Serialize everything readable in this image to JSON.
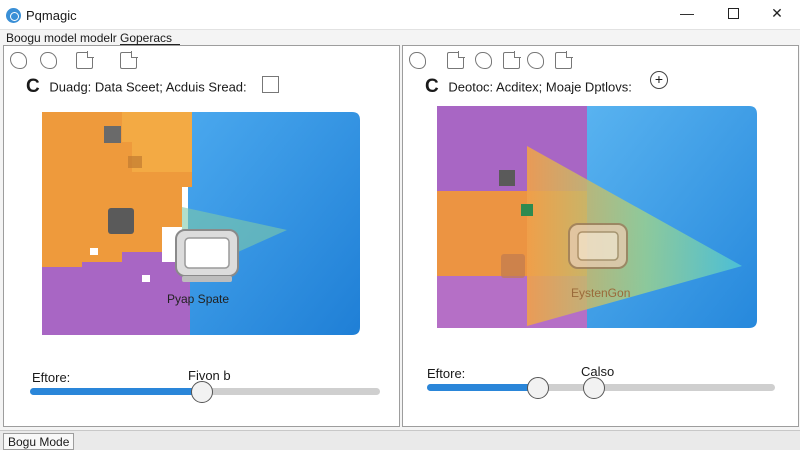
{
  "window": {
    "title": "Pqmagic",
    "minimize_glyph": "—",
    "close_glyph": "✕"
  },
  "menu": {
    "items": [
      "Boogu model modelr",
      "Goperacs"
    ]
  },
  "left_panel": {
    "header_letter": "C",
    "header_text": "Duadg: Data Sceet; Acduis Sread:",
    "canvas_label": "Pyap Spate",
    "slider": {
      "label": "Eftore:",
      "caption": "Fivon b",
      "value_fraction": 0.49
    }
  },
  "right_panel": {
    "header_letter": "C",
    "header_text": "Deotoc: Acditex; Moaje Dptlovs:",
    "plus_glyph": "+",
    "canvas_label": "EystenGon",
    "slider": {
      "label": "Eftore:",
      "caption": "Calso",
      "value_fraction": 0.32,
      "second_thumb_fraction": 0.48
    }
  },
  "status": {
    "text": "Bogu Mode"
  },
  "colors": {
    "accent": "#2a86d9",
    "orange": "#ee9a3c",
    "purple": "#a866c4",
    "blue": "#2a8ddf"
  }
}
